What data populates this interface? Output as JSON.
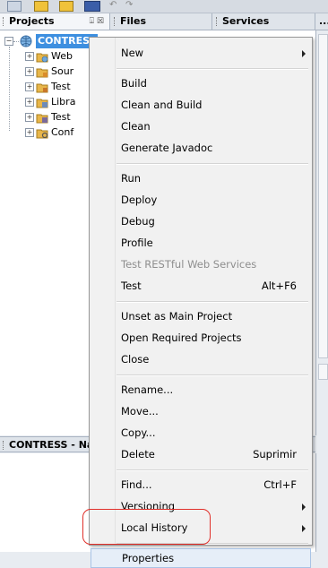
{
  "tabs": {
    "projects": "Projects",
    "files": "Files",
    "services": "Services",
    "more": "..."
  },
  "tab_controls": "⍗ ☒",
  "tree": {
    "root": "CONTRESS",
    "children": [
      "Web",
      "Sour",
      "Test",
      "Libra",
      "Test",
      "Conf"
    ]
  },
  "navigator": {
    "title": "CONTRESS - Na"
  },
  "menu": {
    "items": [
      {
        "label": "New",
        "submenu": true
      },
      {
        "sep": true
      },
      {
        "label": "Build"
      },
      {
        "label": "Clean and Build"
      },
      {
        "label": "Clean"
      },
      {
        "label": "Generate Javadoc"
      },
      {
        "sep": true
      },
      {
        "label": "Run"
      },
      {
        "label": "Deploy"
      },
      {
        "label": "Debug"
      },
      {
        "label": "Profile"
      },
      {
        "label": "Test RESTful Web Services",
        "disabled": true
      },
      {
        "label": "Test",
        "accel": "Alt+F6"
      },
      {
        "sep": true
      },
      {
        "label": "Unset as Main Project"
      },
      {
        "label": "Open Required Projects"
      },
      {
        "label": "Close"
      },
      {
        "sep": true
      },
      {
        "label": "Rename..."
      },
      {
        "label": "Move..."
      },
      {
        "label": "Copy..."
      },
      {
        "label": "Delete",
        "accel": "Suprimir"
      },
      {
        "sep": true
      },
      {
        "label": "Find...",
        "accel": "Ctrl+F"
      },
      {
        "label": "Versioning",
        "submenu": true
      },
      {
        "label": "Local History",
        "submenu": true
      },
      {
        "sep": true
      },
      {
        "label": "Properties",
        "highlighted": true
      }
    ]
  },
  "colors": {
    "selection": "#3d8fe0",
    "highlight_ring": "#e0302a"
  }
}
